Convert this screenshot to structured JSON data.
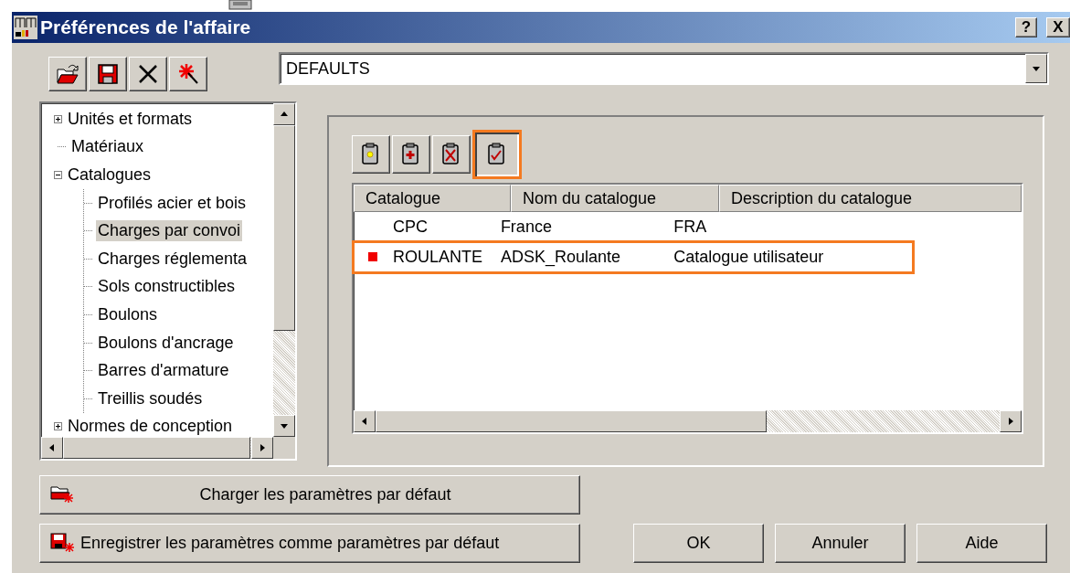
{
  "window": {
    "title": "Préférences de l'affaire",
    "help_button": "?",
    "close_button": "X"
  },
  "profile_combo": {
    "value": "DEFAULTS"
  },
  "tree": [
    {
      "label": "Unités et formats",
      "expanded": false,
      "selected": false
    },
    {
      "label": "Matériaux",
      "selected": false
    },
    {
      "label": "Catalogues",
      "expanded": true,
      "selected": false,
      "children": [
        {
          "label": "Profilés acier et bois",
          "selected": false
        },
        {
          "label": "Charges par convoi",
          "selected": true
        },
        {
          "label": "Charges réglementa",
          "selected": false
        },
        {
          "label": "Sols constructibles",
          "selected": false
        },
        {
          "label": "Boulons",
          "selected": false
        },
        {
          "label": "Boulons d'ancrage",
          "selected": false
        },
        {
          "label": "Barres d'armature",
          "selected": false
        },
        {
          "label": "Treillis soudés",
          "selected": false
        }
      ]
    },
    {
      "label": "Normes de conception",
      "expanded": false,
      "selected": false
    }
  ],
  "catalog_toolbar": [
    {
      "kind": "new",
      "highlighted": false
    },
    {
      "kind": "add",
      "highlighted": false
    },
    {
      "kind": "delete",
      "highlighted": false
    },
    {
      "kind": "activate",
      "highlighted": true
    }
  ],
  "table": {
    "columns": [
      "Catalogue",
      "Nom du catalogue",
      "Description du catalogue"
    ],
    "rows": [
      {
        "active": false,
        "highlighted": false,
        "cells": [
          "CPC",
          "France",
          "FRA"
        ]
      },
      {
        "active": true,
        "highlighted": true,
        "cells": [
          "ROULANTE",
          "ADSK_Roulante",
          "Catalogue utilisateur"
        ]
      }
    ]
  },
  "buttons": {
    "load_defaults": "Charger les paramètres par défaut",
    "save_defaults": "Enregistrer les paramètres comme paramètres par défaut",
    "ok": "OK",
    "cancel": "Annuler",
    "help": "Aide"
  }
}
